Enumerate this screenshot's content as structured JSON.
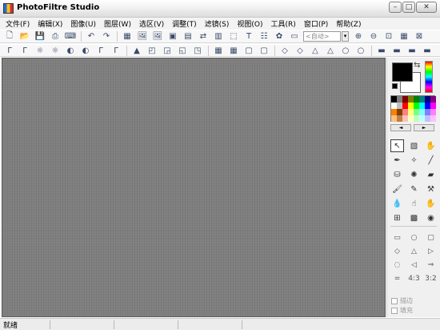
{
  "window": {
    "title": "PhotoFiltre Studio",
    "minimize": "–",
    "maximize": "□",
    "close": "✕"
  },
  "menu": [
    "文件(F)",
    "编辑(X)",
    "图像(U)",
    "图层(W)",
    "选区(V)",
    "调整(T)",
    "滤镜(S)",
    "视图(O)",
    "工具(R)",
    "窗口(P)",
    "帮助(Z)"
  ],
  "toolbar1": {
    "icons_a": [
      "new-file-icon",
      "open-folder-icon",
      "save-icon",
      "print-icon",
      "scanner-icon"
    ],
    "icons_b": [
      "undo-icon",
      "redo-icon"
    ],
    "icons_c": [
      "fill-icon",
      "image-icon",
      "image-icon",
      "frame-icon",
      "page-icon",
      "flip-icon",
      "text-page-icon",
      "select-icon",
      "text-icon",
      "layers-icon",
      "settings-icon",
      "window-icon"
    ],
    "auto_value": "<自动>",
    "icons_d": [
      "zoom-in-icon",
      "zoom-out-icon",
      "fit-icon",
      "full-icon",
      "actual-size-icon"
    ],
    "glyphs": {
      "new-file-icon": "🗋",
      "open-folder-icon": "📂",
      "save-icon": "💾",
      "print-icon": "⎙",
      "scanner-icon": "⌨",
      "undo-icon": "↶",
      "redo-icon": "↷",
      "fill-icon": "▦",
      "image-icon": "🖼",
      "frame-icon": "▣",
      "page-icon": "▤",
      "flip-icon": "⇄",
      "text-page-icon": "▥",
      "select-icon": "⬚",
      "text-icon": "T",
      "layers-icon": "☷",
      "settings-icon": "✿",
      "window-icon": "▭",
      "zoom-in-icon": "⊕",
      "zoom-out-icon": "⊖",
      "fit-icon": "⊡",
      "full-icon": "▦",
      "actual-size-icon": "⊠"
    }
  },
  "toolbar2": {
    "icons": [
      "adjust-icon",
      "adjust-icon",
      "brightness-icon",
      "brightness-icon",
      "contrast-icon",
      "contrast-icon",
      "gamma-icon",
      "gamma-icon",
      "levels-icon",
      "filter-icon",
      "sharpen-icon",
      "blur-icon",
      "emboss-icon",
      "grid-icon",
      "grid-icon",
      "frame-icon",
      "frame-icon",
      "drop-icon",
      "drop-icon",
      "triangle-icon",
      "triangle-icon",
      "sphere-icon",
      "sphere-icon",
      "plugin-icon",
      "plugin-icon",
      "plugin-icon",
      "plugin-icon"
    ],
    "glyphs": {
      "adjust-icon": "Γ",
      "brightness-icon": "☼",
      "contrast-icon": "◐",
      "gamma-icon": "Γ",
      "levels-icon": "▲",
      "filter-icon": "◰",
      "sharpen-icon": "◲",
      "blur-icon": "◱",
      "emboss-icon": "◳",
      "grid-icon": "▦",
      "frame-icon": "▢",
      "drop-icon": "◇",
      "triangle-icon": "△",
      "sphere-icon": "○",
      "plugin-icon": "▬"
    }
  },
  "colors": {
    "palette": [
      "#000000",
      "#808080",
      "#800000",
      "#808000",
      "#008000",
      "#008080",
      "#000080",
      "#800080",
      "#ffffff",
      "#c0c0c0",
      "#ff0000",
      "#ffff00",
      "#00ff00",
      "#00ffff",
      "#0000ff",
      "#ff00ff",
      "#ff8000",
      "#804000",
      "#ff8080",
      "#ffff80",
      "#80ff80",
      "#80ffff",
      "#8080ff",
      "#ff80ff",
      "#ffc080",
      "#c08040",
      "#ffc0c0",
      "#ffffc0",
      "#c0ffc0",
      "#c0ffff",
      "#c0c0ff",
      "#ffc0ff"
    ],
    "foreground": "#000000",
    "background": "#ffffff"
  },
  "palette_nav": {
    "prev": "◄",
    "next": "►"
  },
  "tools": [
    {
      "name": "pointer-tool",
      "glyph": "↖"
    },
    {
      "name": "rect-select-tool",
      "glyph": "▧"
    },
    {
      "name": "hand-tool",
      "glyph": "✋"
    },
    {
      "name": "eyedropper-tool",
      "glyph": "✒"
    },
    {
      "name": "magic-wand-tool",
      "glyph": "✧"
    },
    {
      "name": "line-tool",
      "glyph": "╱"
    },
    {
      "name": "bucket-tool",
      "glyph": "⛁"
    },
    {
      "name": "spray-tool",
      "glyph": "✺"
    },
    {
      "name": "eraser-tool",
      "glyph": "▰"
    },
    {
      "name": "brush-tool",
      "glyph": "🖌"
    },
    {
      "name": "pen-tool",
      "glyph": "✎"
    },
    {
      "name": "stamp-tool",
      "glyph": "⚒"
    },
    {
      "name": "blur-tool",
      "glyph": "💧"
    },
    {
      "name": "finger-tool",
      "glyph": "☝"
    },
    {
      "name": "smudge-tool",
      "glyph": "✋"
    },
    {
      "name": "clone-tool",
      "glyph": "⊞"
    },
    {
      "name": "pattern-tool",
      "glyph": "▩"
    },
    {
      "name": "red-eye-tool",
      "glyph": "◉"
    }
  ],
  "shapes": [
    {
      "name": "rectangle-shape",
      "glyph": "▭"
    },
    {
      "name": "ellipse-shape",
      "glyph": "○"
    },
    {
      "name": "rounded-shape",
      "glyph": "▢"
    },
    {
      "name": "diamond-shape",
      "glyph": "◇"
    },
    {
      "name": "triangle-shape",
      "glyph": "△"
    },
    {
      "name": "play-shape",
      "glyph": "▷"
    },
    {
      "name": "lasso-shape",
      "glyph": "◌"
    },
    {
      "name": "polygon-shape",
      "glyph": "◁"
    },
    {
      "name": "import-shape",
      "glyph": "⇒"
    },
    {
      "name": "equal-shape",
      "glyph": "="
    },
    {
      "name": "ratio-43",
      "glyph": "4:3"
    },
    {
      "name": "ratio-32",
      "glyph": "3:2"
    }
  ],
  "options": {
    "stroke": "描边",
    "fill": "填充"
  },
  "status": {
    "text": "就绪"
  }
}
